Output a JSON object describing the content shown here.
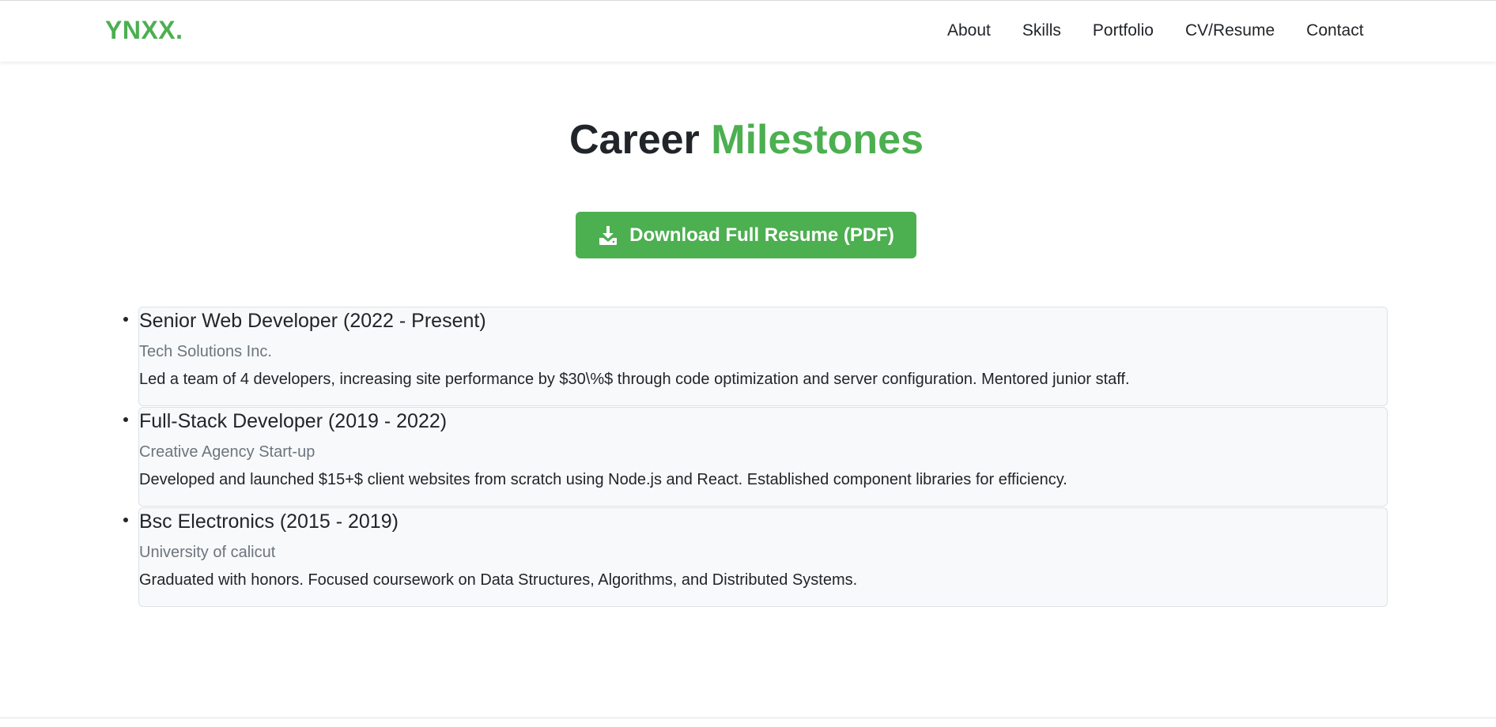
{
  "header": {
    "logo": "YNXX.",
    "nav": [
      {
        "label": "About"
      },
      {
        "label": "Skills"
      },
      {
        "label": "Portfolio"
      },
      {
        "label": "CV/Resume"
      },
      {
        "label": "Contact"
      }
    ]
  },
  "main": {
    "title_part1": "Career",
    "title_part2": "Milestones",
    "download_label": "Download Full Resume (PDF)",
    "download_icon": "download-icon",
    "milestones": [
      {
        "title": "Senior Web Developer (2022 - Present)",
        "org": "Tech Solutions Inc.",
        "desc": "Led a team of 4 developers, increasing site performance by $30\\%$ through code optimization and server configuration. Mentored junior staff."
      },
      {
        "title": "Full-Stack Developer (2019 - 2022)",
        "org": "Creative Agency Start-up",
        "desc": "Developed and launched $15+$ client websites from scratch using Node.js and React. Established component libraries for efficiency."
      },
      {
        "title": "Bsc Electronics (2015 - 2019)",
        "org": "University of calicut",
        "desc": "Graduated with honors. Focused coursework on Data Structures, Algorithms, and Distributed Systems."
      }
    ]
  },
  "colors": {
    "accent": "#4caf50",
    "text": "#212529",
    "muted": "#6c757d",
    "card_bg": "#f8f9fa"
  }
}
